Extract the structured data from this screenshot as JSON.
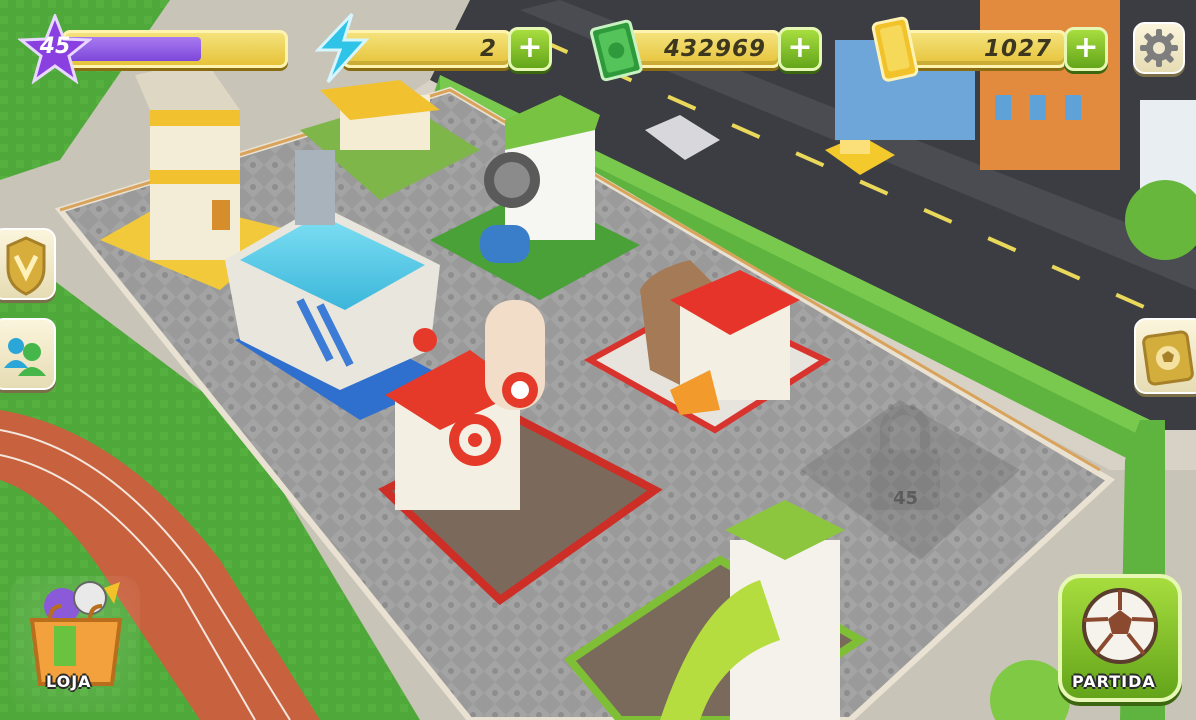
{
  "player": {
    "level": "45",
    "xp_progress": 0.62
  },
  "currencies": {
    "energy": "2",
    "cash": "432969",
    "gold": "1027"
  },
  "buttons": {
    "shop_label": "LOJA",
    "match_label": "PARTIDA"
  },
  "locked_plot": {
    "level": "45"
  },
  "colors": {
    "xp_fill": "#8e58e6",
    "level_star": "#8a3fe0",
    "energy_bolt": "#2fc3e8",
    "cash": "#42b84b",
    "gold": "#f2c22a",
    "plus_button": "#7bbb28"
  },
  "icons": {
    "level": "star-icon",
    "energy": "lightning-bolt-icon",
    "cash": "cash-bill-icon",
    "gold": "gold-bar-icon",
    "settings": "gear-icon",
    "achievements": "shield-v-badge-icon",
    "friends": "friends-icon",
    "sticker_album": "ball-album-icon",
    "shop": "shopping-bag-icon",
    "match": "soccer-ball-icon",
    "locked_plot": "padlock-icon"
  }
}
